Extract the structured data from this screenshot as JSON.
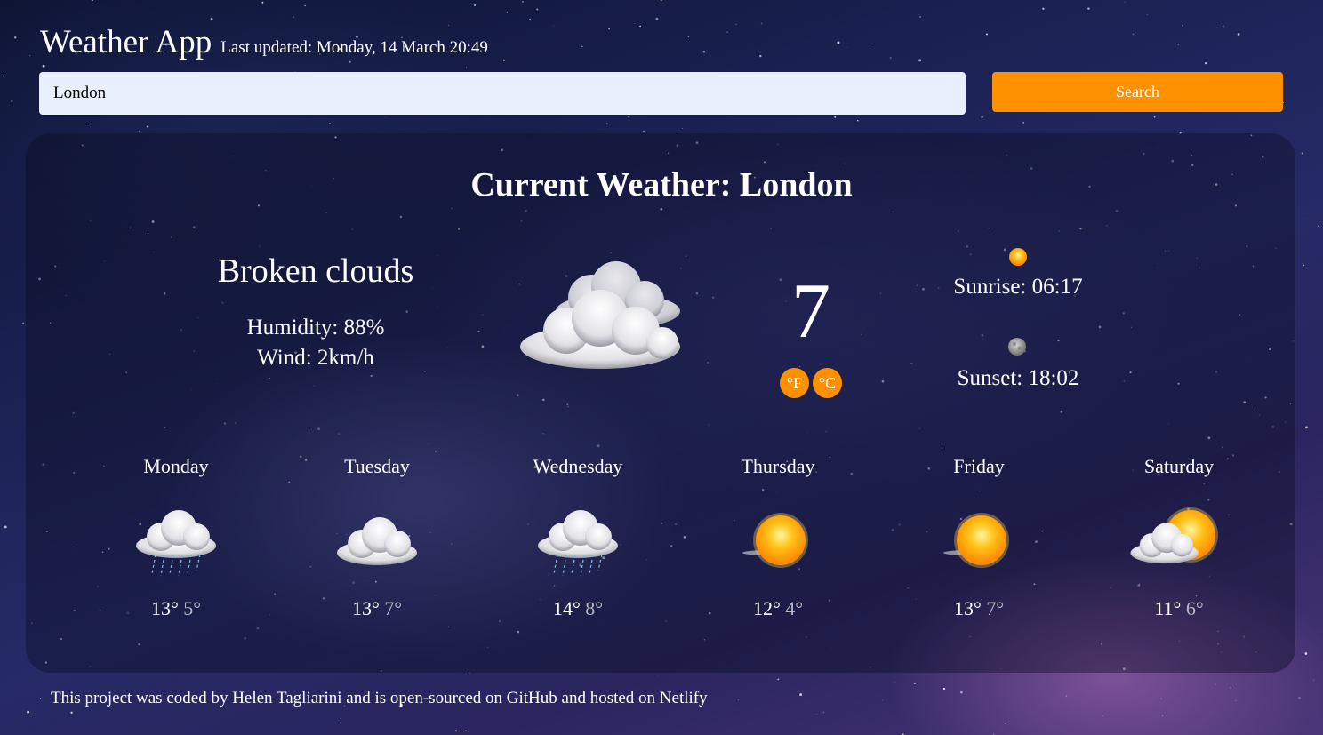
{
  "header": {
    "title": "Weather App",
    "last_updated": "Last updated: Monday, 14 March 20:49"
  },
  "search": {
    "value": "London",
    "button_label": "Search"
  },
  "current": {
    "title": "Current Weather: London",
    "description": "Broken clouds",
    "humidity": "Humidity: 88%",
    "wind": "Wind: 2km/h",
    "temperature": "7",
    "icon": "broken-clouds-icon",
    "unit_f": "°F",
    "unit_c": "°C",
    "sunrise": "Sunrise: 06:17",
    "sunset": "Sunset: 18:02"
  },
  "forecast": [
    {
      "day": "Monday",
      "high": "13°",
      "low": "5°",
      "icon": "rain-cloud-icon"
    },
    {
      "day": "Tuesday",
      "high": "13°",
      "low": "7°",
      "icon": "cloud-icon"
    },
    {
      "day": "Wednesday",
      "high": "14°",
      "low": "8°",
      "icon": "rain-cloud-icon"
    },
    {
      "day": "Thursday",
      "high": "12°",
      "low": "4°",
      "icon": "sun-icon"
    },
    {
      "day": "Friday",
      "high": "13°",
      "low": "7°",
      "icon": "sun-icon"
    },
    {
      "day": "Saturday",
      "high": "11°",
      "low": "6°",
      "icon": "sun-cloud-icon"
    }
  ],
  "footer": {
    "text": "This project was coded by Helen Tagliarini and is open-sourced on GitHub and hosted on Netlify"
  },
  "colors": {
    "accent": "#ff9100",
    "input_bg": "#e8f0fe"
  }
}
